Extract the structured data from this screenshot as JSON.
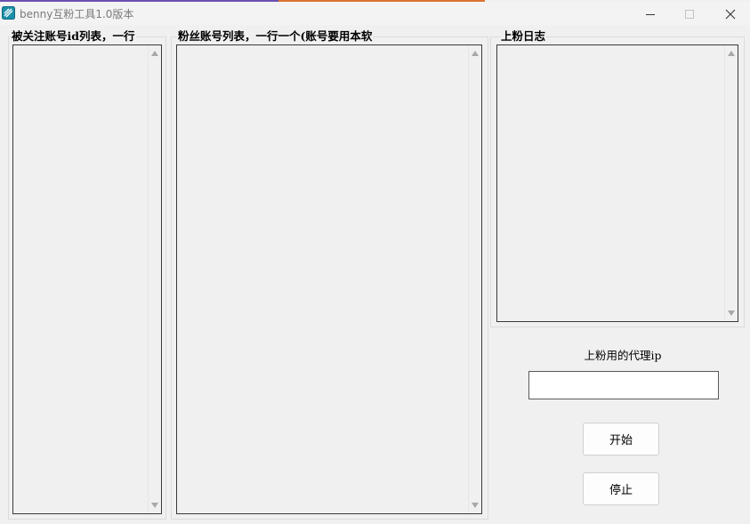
{
  "window": {
    "title": "benny互粉工具1.0版本",
    "accent_colors": [
      "#6a4fb0",
      "#d9742e"
    ]
  },
  "groups": {
    "followed_ids": {
      "title": "被关注账号id列表，一行"
    },
    "fan_accounts": {
      "title": "粉丝账号列表，一行一个(账号要用本软"
    },
    "log": {
      "title": "上粉日志"
    }
  },
  "proxy": {
    "label": "上粉用的代理ip",
    "value": ""
  },
  "buttons": {
    "start": "开始",
    "stop": "停止"
  },
  "icons": {
    "app": "app-logo-icon",
    "minimize": "minimize-icon",
    "maximize": "maximize-icon",
    "close": "close-icon"
  }
}
